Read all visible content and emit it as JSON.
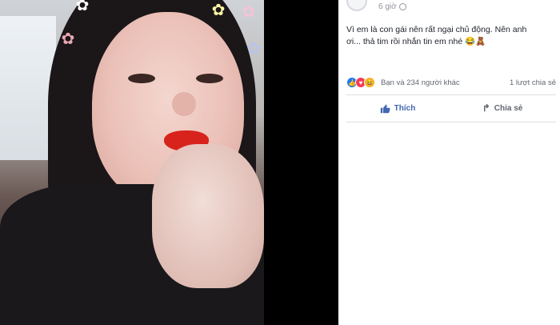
{
  "post": {
    "time": "6 giờ",
    "privacy_icon": "globe-icon",
    "text_line1": "Vì em là con gái nên rất ngại chủ động. Nên anh",
    "text_line2": "ơi... thả tim rồi nhắn tin em nhé 😂🧸"
  },
  "reactions": {
    "icons": [
      "like-icon",
      "love-icon",
      "haha-icon"
    ],
    "summary": "Bạn và 234 người khác",
    "shares": "1 lượt chia sẻ"
  },
  "actions": {
    "like_label": "Thích",
    "share_label": "Chia sẻ"
  },
  "colors": {
    "like_blue": "#4267b2",
    "love_red": "#f33e58",
    "haha_yellow": "#f7b125"
  }
}
